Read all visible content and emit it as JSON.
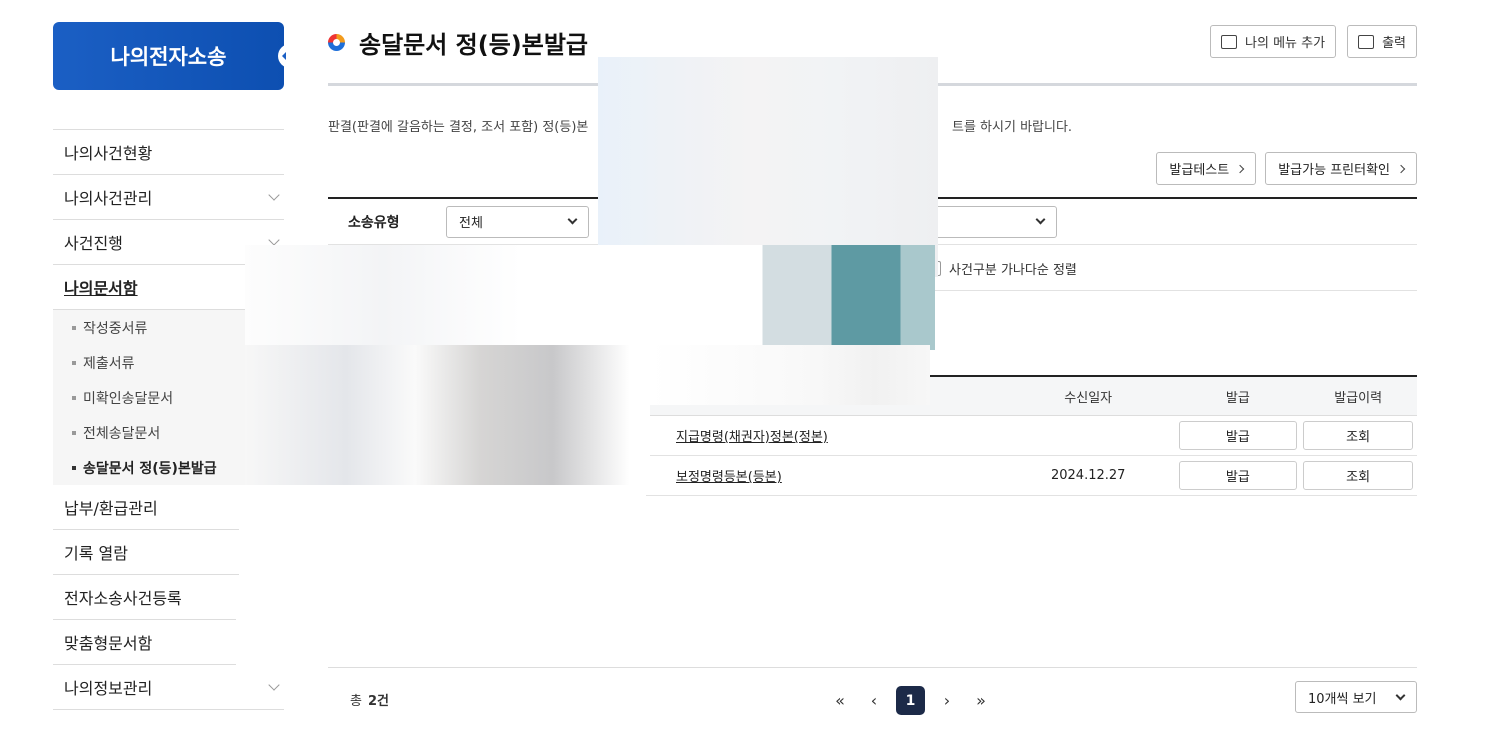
{
  "brand": "나의전자소송",
  "sidebar": {
    "items": [
      {
        "label": "나의사건현황"
      },
      {
        "label": "나의사건관리"
      },
      {
        "label": "사건진행"
      },
      {
        "label": "나의문서함"
      },
      {
        "label": "납부/환급관리"
      },
      {
        "label": "기록 열람"
      },
      {
        "label": "전자소송사건등록"
      },
      {
        "label": "맞춤형문서함"
      },
      {
        "label": "나의정보관리"
      }
    ],
    "sub_items": [
      {
        "label": "작성중서류"
      },
      {
        "label": "제출서류"
      },
      {
        "label": "미확인송달문서"
      },
      {
        "label": "전체송달문서"
      },
      {
        "label": "송달문서 정(등)본발급"
      }
    ]
  },
  "page": {
    "title": "송달문서 정(등)본발급",
    "add_menu": "나의 메뉴 추가",
    "print": "출력",
    "desc_left": "판결(판결에 갈음하는 결정, 조서 포함) 정(등)본",
    "desc_right": "트를 하시기 바랍니다.",
    "issue_test": "발급테스트",
    "printer_check": "발급가능 프린터확인"
  },
  "search": {
    "type_label": "소송유형",
    "type_value": "전체",
    "sort_label": "사건구분 가나다순 정렬"
  },
  "table": {
    "headers": [
      "수신일자",
      "발급",
      "발급이력"
    ],
    "rows": [
      {
        "doc": "지급명령(채권자)정본(정본)",
        "date": "",
        "issue": "발급",
        "history": "조회"
      },
      {
        "doc": "보정명령등본(등본)",
        "date": "2024.12.27",
        "issue": "발급",
        "history": "조회"
      }
    ]
  },
  "footer": {
    "total_prefix": "총",
    "total_count": "2건",
    "current_page": "1",
    "per_page": "10개씩 보기"
  }
}
